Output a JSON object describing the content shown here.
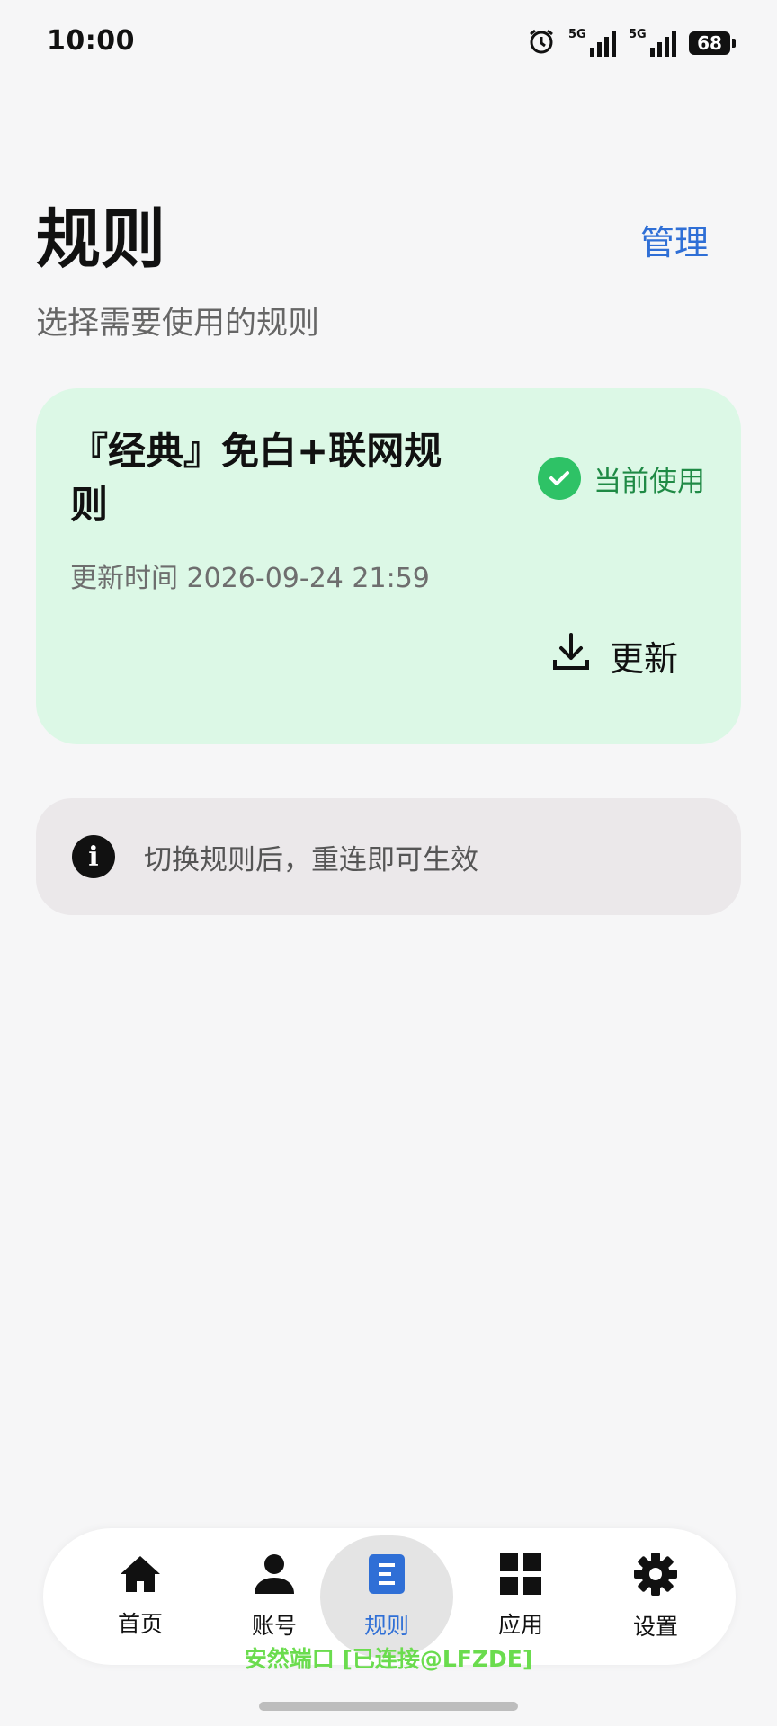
{
  "status_bar": {
    "time": "10:00",
    "signal1": "5G",
    "signal2": "5G",
    "battery": "68"
  },
  "header": {
    "title": "规则",
    "manage_label": "管理",
    "subtitle": "选择需要使用的规则"
  },
  "rule_card": {
    "name": "『经典』免白+联网规则",
    "current_label": "当前使用",
    "updated_text": "更新时间 2026-09-24 21:59",
    "update_label": "更新",
    "accent_color": "#2ec266"
  },
  "info": {
    "text": "切换规则后，重连即可生效"
  },
  "nav": {
    "items": [
      {
        "label": "首页",
        "icon": "home-icon"
      },
      {
        "label": "账号",
        "icon": "person-icon"
      },
      {
        "label": "规则",
        "icon": "document-icon"
      },
      {
        "label": "应用",
        "icon": "grid-icon"
      },
      {
        "label": "设置",
        "icon": "gear-icon"
      }
    ],
    "active_index": 2,
    "active_color": "#2f6fd6"
  },
  "footer": {
    "connect_status": "安然端口 [已连接@LFZDE]"
  }
}
